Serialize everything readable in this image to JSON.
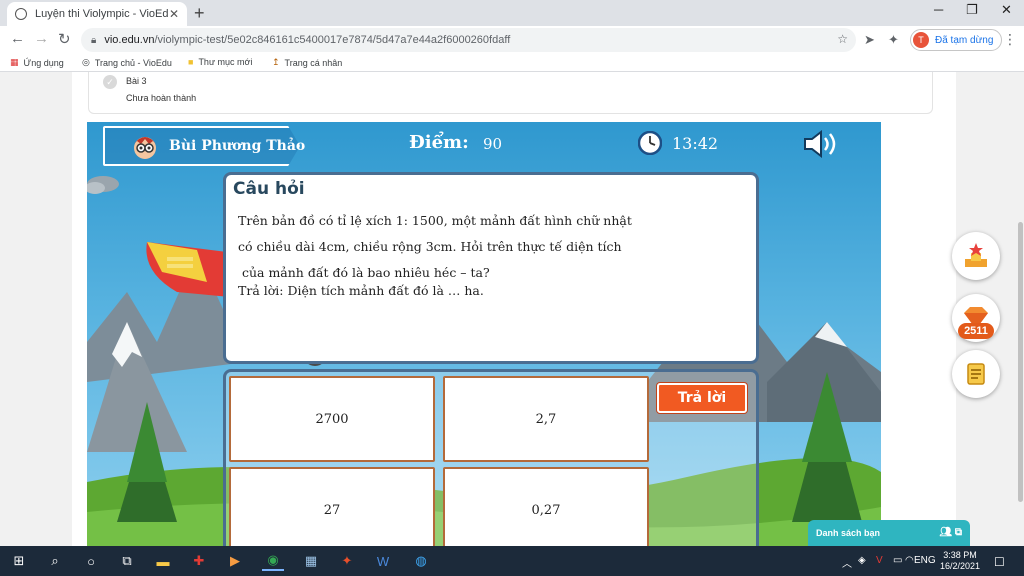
{
  "browser": {
    "tab_title": "Luyện thi Violympic - VioEdu",
    "url_domain": "vio.edu.vn",
    "url_path": "/violympic-test/5e02c846161c5400017e7874/5d47a7e44a2f6000260fdaff",
    "profile_initial": "T",
    "profile_label": "Đã tạm dừng",
    "bookmarks": [
      "Ứng dụng",
      "Trang chủ - VioEdu",
      "Thư mục mới",
      "Trang cá nhân"
    ]
  },
  "lesson": {
    "name": "Bài 3",
    "status": "Chưa hoàn thành"
  },
  "game": {
    "player_name": "Bùi Phương Thảo",
    "score_label": "Điểm:",
    "score_value": "90",
    "timer": "13:42",
    "question_title": "Câu hỏi",
    "question_lines": [
      "Trên bản đồ có tỉ lệ xích 1: 1500, một mảnh đất hình chữ nhật",
      "có chiều dài 4cm, chiều rộng 3cm. Hỏi trên thực tế diện tích",
      " của mảnh đất đó là bao nhiêu héc – ta?",
      "Trả lời: Diện tích mảnh đất đó là  …  ha."
    ],
    "options": [
      "2700",
      "2,7",
      "27",
      "0,27"
    ],
    "answer_button": "Trả lời"
  },
  "side": {
    "gem_count": "2511",
    "friends_label": "Danh sách bạn"
  },
  "taskbar": {
    "lang": "ENG",
    "time": "3:38 PM",
    "date": "16/2/2021"
  },
  "colors": {
    "accent_orange": "#f15a22",
    "frame_blue": "#4a6d91",
    "option_border": "#b46a3a"
  }
}
